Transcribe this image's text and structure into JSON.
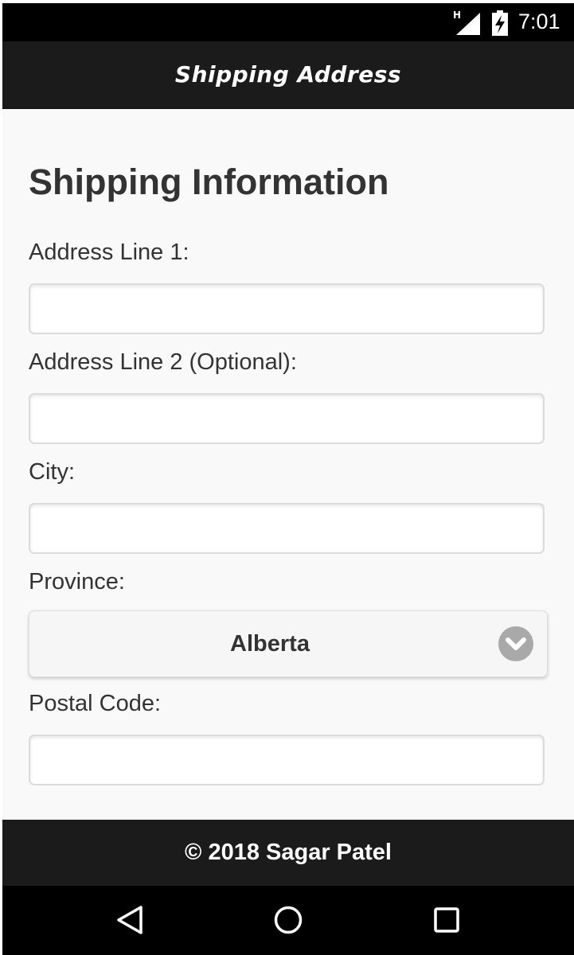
{
  "status_bar": {
    "network_type": "H",
    "time": "7:01",
    "icons": [
      "signal-icon",
      "battery-charging-icon"
    ]
  },
  "header": {
    "title": "Shipping Address"
  },
  "form": {
    "heading": "Shipping Information",
    "address_line1": {
      "label": "Address Line 1:",
      "value": ""
    },
    "address_line2": {
      "label": "Address Line 2 (Optional):",
      "value": ""
    },
    "city": {
      "label": "City:",
      "value": ""
    },
    "province": {
      "label": "Province:",
      "selected": "Alberta",
      "icon": "chevron-down-icon"
    },
    "postal_code": {
      "label": "Postal Code:",
      "value": ""
    }
  },
  "footer": {
    "text": "© 2018 Sagar Patel"
  },
  "nav_bar": {
    "icons": [
      "back-icon",
      "home-icon",
      "recents-icon"
    ]
  },
  "colors": {
    "header_bg": "#1b1b1b",
    "content_bg": "#f9f9f9",
    "text": "#333333",
    "chevron_bg": "#a9a9a9"
  }
}
